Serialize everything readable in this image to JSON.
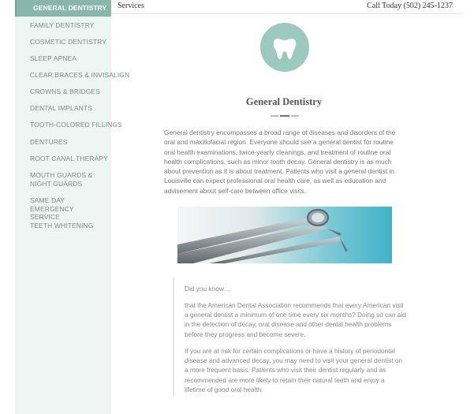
{
  "topbar": {
    "section_label": "Services",
    "call_text": "Call Today (502) 245-1237"
  },
  "sidebar": {
    "items": [
      {
        "label": "GENERAL DENTISTRY",
        "active": true
      },
      {
        "label": "FAMILY DENTISTRY"
      },
      {
        "label": "COSMETIC DENTISTRY"
      },
      {
        "label": "SLEEP APNEA"
      },
      {
        "label": "CLEAR BRACES & INVISALIGN"
      },
      {
        "label": "CROWNS & BRIDGES"
      },
      {
        "label": "DENTAL IMPLANTS"
      },
      {
        "label": "TOOTH-COLORED FILLINGS"
      },
      {
        "label": "DENTURES"
      },
      {
        "label": "ROOT CANAL THERAPY"
      },
      {
        "label": "MOUTH GUARDS & NIGHT GUARDS"
      },
      {
        "label": "SAME DAY EMERGENCY SERVICE"
      },
      {
        "label": "TEETH WHITENING"
      }
    ]
  },
  "main": {
    "icon": "tooth-icon",
    "title": "General Dentistry",
    "intro": "General dentistry encompasses a broad range of diseases and disorders of the oral and maxillofacial region. Everyone should see a general dentist for routine oral health examinations, twice-yearly cleanings, and treatment of routine oral health complications, such as minor tooth decay. General dentistry is as much about prevention as it is about treatment. Patients who visit a general dentist in Louisville can expect professional oral health care, as well as education and advisement about self-care between office visits.",
    "photo": "dental-instruments-image",
    "callout": {
      "heading": "Did you know…",
      "p1": "that the American Dental Association recommends that every American visit a general dentist a minimum of one time every six months? Doing so can aid in the detection of decay, oral disease and other dental health problems before they progress and become severe.",
      "p2": "If you are at risk for certain complications or have a history of periodontal disease and advanced decay, you may need to visit your general dentist on a more frequent basis. Patients who visit their dentist regularly and as recommended are more likely to retain their natural teeth and enjoy a lifetime of good oral health."
    }
  },
  "colors": {
    "sidebar_bg": "#eef6f3",
    "active_item": "#88b6ad",
    "accent_teal": "#9cc9bf",
    "rule_tan": "#c9b9a4",
    "rule_dark": "#7a6e64"
  }
}
